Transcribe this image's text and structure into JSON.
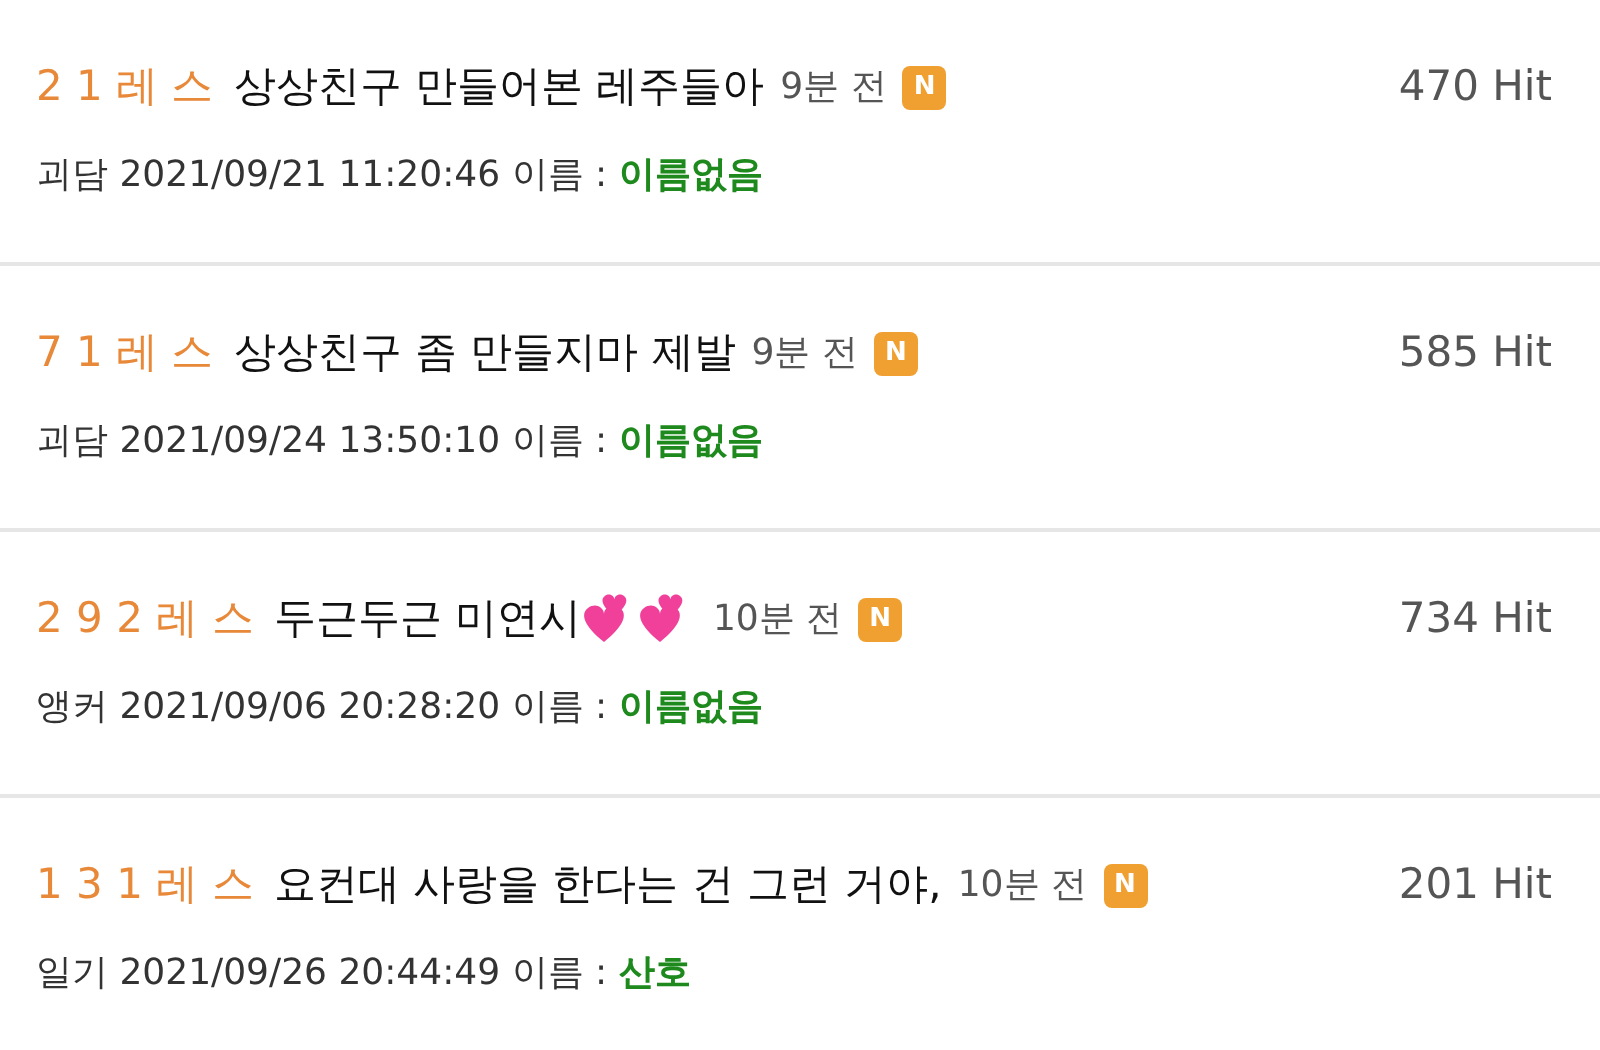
{
  "posts": [
    {
      "count": "2 1 레 스",
      "title": "상상친구 만들어본 레주들아",
      "time": "9분 전",
      "badge": "N",
      "hits": "470 Hit",
      "meta": "괴담 2021/09/21 11:20:46 이름 :",
      "author": "이름없음"
    },
    {
      "count": "7 1 레 스",
      "title": "상상친구 좀 만들지마 제발",
      "time": "9분 전",
      "badge": "N",
      "hits": "585 Hit",
      "meta": "괴담 2021/09/24 13:50:10 이름 :",
      "author": "이름없음"
    },
    {
      "count": "2 9 2 레 스",
      "title": "두근두근 미연시",
      "hearts": true,
      "time": "10분 전",
      "badge": "N",
      "hits": "734 Hit",
      "meta": "앵커 2021/09/06 20:28:20 이름 :",
      "author": "이름없음"
    },
    {
      "count": "1 3 1 레 스",
      "title": "요컨대 사랑을 한다는 건 그런 거야,",
      "time": "10분 전",
      "badge": "N",
      "hits": "201 Hit",
      "meta": "일기 2021/09/26 20:44:49 이름 :",
      "author": "산호"
    }
  ]
}
